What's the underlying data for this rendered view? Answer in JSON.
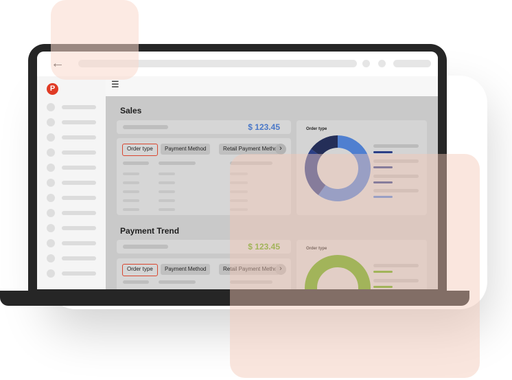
{
  "colors": {
    "brand": "#e03b25",
    "sales_amount": "#4a78c8",
    "trend_amount": "#5fa50f",
    "donut_light_blue": "#4f7fd0",
    "donut_dark_blue": "#2c3f86",
    "donut_navy": "#242e58",
    "donut_green": "#5fa50f",
    "active_chip_border": "#d9462f"
  },
  "sales": {
    "title": "Sales",
    "amount": "$ 123.45",
    "tabs": [
      "Order type",
      "Payment Method",
      "Retail Payment Method"
    ],
    "chart_label": "Order type"
  },
  "payment_trend": {
    "title": "Payment Trend",
    "amount": "$ 123.45",
    "tabs": [
      "Order type",
      "Payment Method",
      "Retail Payment Method"
    ],
    "chart_label": "Order type"
  },
  "icons": {
    "back": "back-arrow-icon",
    "menu": "hamburger-menu-icon",
    "scroll": "chevron-right-icon",
    "logo_letter": "P"
  },
  "chart_data": [
    {
      "type": "pie",
      "title": "Order type",
      "slices": [
        {
          "label": "",
          "value": 60,
          "color": "#4f7fd0"
        },
        {
          "label": "",
          "value": 25,
          "color": "#2c3f86"
        },
        {
          "label": "",
          "value": 15,
          "color": "#242e58"
        }
      ]
    },
    {
      "type": "pie",
      "title": "Order type",
      "slices": [
        {
          "label": "",
          "value": 100,
          "color": "#5fa50f"
        }
      ]
    }
  ]
}
